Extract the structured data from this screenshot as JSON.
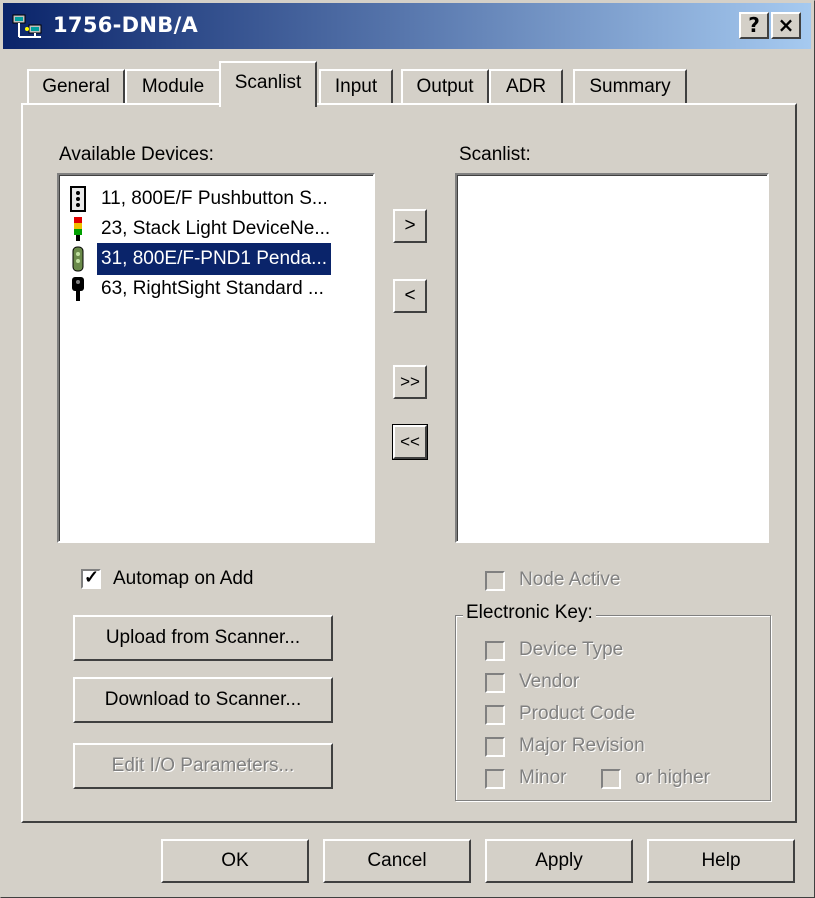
{
  "window": {
    "title": "1756-DNB/A",
    "help_button": "?",
    "close_button": "×"
  },
  "tabs": [
    {
      "label": "General"
    },
    {
      "label": "Module"
    },
    {
      "label": "Scanlist"
    },
    {
      "label": "Input"
    },
    {
      "label": "Output"
    },
    {
      "label": "ADR"
    },
    {
      "label": "Summary"
    }
  ],
  "available_devices": {
    "label": "Available Devices:",
    "items": [
      {
        "label": "11, 800E/F Pushbutton S...",
        "icon": "pushbutton-icon",
        "selected": false
      },
      {
        "label": "23, Stack Light DeviceNe...",
        "icon": "stack-light-icon",
        "selected": false
      },
      {
        "label": "31, 800E/F-PND1 Penda...",
        "icon": "pendant-icon",
        "selected": true
      },
      {
        "label": "63, RightSight Standard ...",
        "icon": "sensor-icon",
        "selected": false
      }
    ]
  },
  "transfer_buttons": {
    "add": ">",
    "remove": "<",
    "add_all": ">>",
    "remove_all": "<<"
  },
  "scanlist": {
    "label": "Scanlist:",
    "items": []
  },
  "automap": {
    "label": "Automap on Add",
    "checked": true
  },
  "buttons": {
    "upload": "Upload from Scanner...",
    "download": "Download to Scanner...",
    "edit_io": "Edit I/O Parameters..."
  },
  "node_active": {
    "label": "Node Active",
    "checked": false,
    "enabled": false
  },
  "electronic_key": {
    "label": "Electronic Key:",
    "device_type": "Device Type",
    "vendor": "Vendor",
    "product_code": "Product Code",
    "major_revision": "Major Revision",
    "minor": "Minor",
    "or_higher": "or higher"
  },
  "footer": {
    "ok": "OK",
    "cancel": "Cancel",
    "apply": "Apply",
    "help": "Help"
  },
  "colors": {
    "titlebar_start": "#0a246a",
    "titlebar_end": "#a6caf0",
    "selection": "#0a246a",
    "face": "#d4d0c8"
  }
}
